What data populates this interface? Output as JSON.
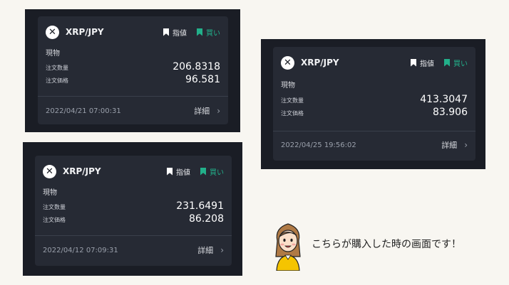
{
  "cards": [
    {
      "logo_icon": "xrp-icon",
      "pair": "XRP/JPY",
      "limit_label": "指値",
      "buy_label": "買い",
      "kind": "現物",
      "qty_label": "注文数量",
      "qty_value": "206.8318",
      "price_label": "注文価格",
      "price_value": "96.581",
      "timestamp": "2022/04/21 07:00:31",
      "detail_label": "詳細"
    },
    {
      "logo_icon": "xrp-icon",
      "pair": "XRP/JPY",
      "limit_label": "指値",
      "buy_label": "買い",
      "kind": "現物",
      "qty_label": "注文数量",
      "qty_value": "413.3047",
      "price_label": "注文価格",
      "price_value": "83.906",
      "timestamp": "2022/04/25 19:56:02",
      "detail_label": "詳細"
    },
    {
      "logo_icon": "xrp-icon",
      "pair": "XRP/JPY",
      "limit_label": "指値",
      "buy_label": "買い",
      "kind": "現物",
      "qty_label": "注文数量",
      "qty_value": "231.6491",
      "price_label": "注文価格",
      "price_value": "86.208",
      "timestamp": "2022/04/12 07:09:31",
      "detail_label": "詳細"
    }
  ],
  "caption": "こちらが購入した時の画面です！",
  "colors": {
    "page_background": "#f8f6f1",
    "panel_background": "#1a1d25",
    "card_background": "#262a34",
    "buy_accent": "#22b08a"
  }
}
